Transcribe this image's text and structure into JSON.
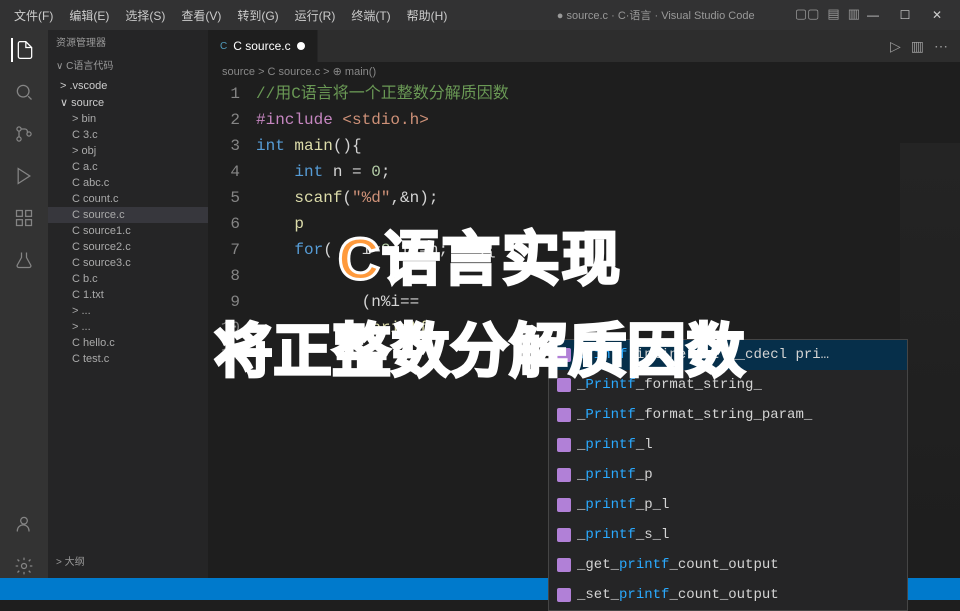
{
  "titlebar": {
    "menus": [
      "文件(F)",
      "编辑(E)",
      "选择(S)",
      "查看(V)",
      "转到(G)",
      "运行(R)",
      "终端(T)",
      "帮助(H)"
    ],
    "title": "● source.c · C·语言 · Visual Studio Code",
    "win_min": "—",
    "win_max": "☐",
    "win_close": "✕"
  },
  "layout_icons": [
    "▢▢",
    "▤",
    "▥"
  ],
  "sidebar": {
    "header": "资源管理器",
    "root": "∨ C语言代码",
    "items": [
      {
        "label": "> .vscode",
        "cls": "folder"
      },
      {
        "label": "∨ source",
        "cls": "folder"
      },
      {
        "label": "> bin",
        "cls": "file"
      },
      {
        "label": "C 3.c",
        "cls": "file"
      },
      {
        "label": "> obj",
        "cls": "file"
      },
      {
        "label": "C a.c",
        "cls": "file"
      },
      {
        "label": "C abc.c",
        "cls": "file"
      },
      {
        "label": "C count.c",
        "cls": "file"
      },
      {
        "label": "C source.c",
        "cls": "file selected"
      },
      {
        "label": "C source1.c",
        "cls": "file"
      },
      {
        "label": "C source2.c",
        "cls": "file"
      },
      {
        "label": "C source3.c",
        "cls": "file"
      },
      {
        "label": "C b.c",
        "cls": "file"
      },
      {
        "label": "C 1.txt",
        "cls": "file"
      },
      {
        "label": "> ...",
        "cls": "file"
      },
      {
        "label": "> ...",
        "cls": "file"
      },
      {
        "label": "C hello.c",
        "cls": "file"
      },
      {
        "label": "C test.c",
        "cls": "file"
      }
    ],
    "outline": "> 大纲"
  },
  "editor": {
    "tab_label": "C source.c",
    "breadcrumb": "source > C source.c > ⊕ main()",
    "lines": [
      {
        "n": "1",
        "html": "<span class='tk-comment'>//用C语言将一个正整数分解质因数</span>"
      },
      {
        "n": "2",
        "html": "<span class='tk-include'>#include</span> <span class='tk-angle'>&lt;stdio.h&gt;</span>"
      },
      {
        "n": "3",
        "html": "<span class='tk-keyword'>int</span> <span class='tk-func'>main</span>(){"
      },
      {
        "n": "4",
        "html": "    <span class='tk-keyword'>int</span> n = <span class='tk-number'>0</span>;"
      },
      {
        "n": "5",
        "html": "    <span class='tk-func'>scanf</span>(<span class='tk-string'>\"%d\"</span>,&amp;n);"
      },
      {
        "n": "6",
        "html": "    <span class='tk-func'>p</span>"
      },
      {
        "n": "7",
        "html": "    <span class='tk-keyword'>for</span>(   i=<span class='tk-number'>2</span>;i&lt;=n;   ){"
      },
      {
        "n": "8",
        "html": "        "
      },
      {
        "n": "9",
        "html": "           (n%i=="
      },
      {
        "n": "10",
        "html": "            <span class='tk-func'>printf</span>"
      },
      {
        "n": "11",
        "html": ""
      }
    ]
  },
  "autocomplete": {
    "items": [
      {
        "html": "<span class='ac-hl'>printf</span>  inline int  __cdecl pri…",
        "sel": true
      },
      {
        "html": "_<span class='ac-hl'>Printf</span>_format_string_"
      },
      {
        "html": "_<span class='ac-hl'>Printf</span>_format_string_param_"
      },
      {
        "html": "_<span class='ac-hl'>printf</span>_l"
      },
      {
        "html": "_<span class='ac-hl'>printf</span>_p"
      },
      {
        "html": "_<span class='ac-hl'>printf</span>_p_l"
      },
      {
        "html": "_<span class='ac-hl'>printf</span>_s_l"
      },
      {
        "html": "_get_<span class='ac-hl'>printf</span>_count_output"
      },
      {
        "html": "_set_<span class='ac-hl'>printf</span>_count_output"
      }
    ]
  },
  "overlay": {
    "line1": "C语言实现",
    "line2": "将正整数分解质因数"
  },
  "activity_icons": [
    "files",
    "search",
    "git",
    "debug",
    "extensions",
    "test",
    "remote"
  ]
}
